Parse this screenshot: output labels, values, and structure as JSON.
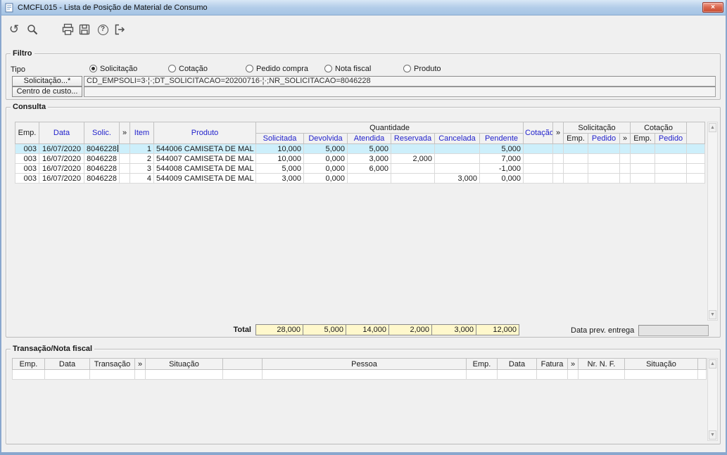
{
  "window": {
    "title": "CMCFL015 - Lista de Posição de Material de Consumo",
    "close_glyph": "×"
  },
  "toolbar": {
    "icons": [
      "undo-icon",
      "search-icon",
      "print-icon",
      "save-icon",
      "help-icon",
      "exit-icon"
    ]
  },
  "filtro": {
    "label": "Filtro",
    "tipo_label": "Tipo",
    "radios": [
      {
        "label": "Solicitação",
        "selected": true
      },
      {
        "label": "Cotação",
        "selected": false
      },
      {
        "label": "Pedido compra",
        "selected": false
      },
      {
        "label": "Nota fiscal",
        "selected": false
      },
      {
        "label": "Produto",
        "selected": false
      }
    ],
    "solicitacao_button": "Solicitação...*",
    "solicitacao_value": "CD_EMPSOLI=3·¦·;DT_SOLICITACAO=20200716·¦·;NR_SOLICITACAO=8046228",
    "centro_custo_button": "Centro de custo...",
    "centro_custo_value": ""
  },
  "consulta": {
    "label": "Consulta",
    "columns": {
      "emp": "Emp.",
      "data": "Data",
      "solic": "Solic.",
      "chev": "»",
      "item": "Item",
      "produto": "Produto",
      "quantidade": "Quantidade",
      "solicitada": "Solicitada",
      "devolvida": "Devolvida",
      "atendida": "Atendida",
      "reservada": "Reservada",
      "cancelada": "Cancelada",
      "pendente": "Pendente",
      "cotacao": "Cotação",
      "solicitacao_group": "Solicitação",
      "cotacao_group": "Cotação",
      "pedido": "Pedido"
    },
    "rows": [
      [
        "003",
        "16/07/2020",
        "8046228",
        "",
        "1",
        "544006 CAMISETA DE MAL",
        "10,000",
        "5,000",
        "5,000",
        "",
        "",
        "5,000",
        "",
        "",
        "",
        "",
        "",
        "",
        ""
      ],
      [
        "003",
        "16/07/2020",
        "8046228",
        "",
        "2",
        "544007 CAMISETA DE MAL",
        "10,000",
        "0,000",
        "3,000",
        "2,000",
        "",
        "7,000",
        "",
        "",
        "",
        "",
        "",
        "",
        ""
      ],
      [
        "003",
        "16/07/2020",
        "8046228",
        "",
        "3",
        "544008 CAMISETA DE MAL",
        "5,000",
        "0,000",
        "6,000",
        "",
        "",
        "-1,000",
        "",
        "",
        "",
        "",
        "",
        "",
        ""
      ],
      [
        "003",
        "16/07/2020",
        "8046228",
        "",
        "4",
        "544009 CAMISETA DE MAL",
        "3,000",
        "0,000",
        "",
        "",
        "3,000",
        "0,000",
        "",
        "",
        "",
        "",
        "",
        "",
        ""
      ]
    ],
    "total_label": "Total",
    "totals": [
      "28,000",
      "5,000",
      "14,000",
      "2,000",
      "3,000",
      "12,000"
    ],
    "data_prev_label": "Data prev. entrega",
    "data_prev_value": ""
  },
  "transacao": {
    "label": "Transação/Nota fiscal",
    "headers": [
      "Emp.",
      "Data",
      "Transação",
      "»",
      "Situação",
      "",
      "Pessoa",
      "Emp.",
      "Data",
      "Fatura",
      "»",
      "Nr. N. F.",
      "Situação"
    ],
    "rows": [
      [
        "",
        "",
        "",
        "",
        "",
        "",
        "",
        "",
        "",
        "",
        "",
        "",
        ""
      ]
    ]
  }
}
